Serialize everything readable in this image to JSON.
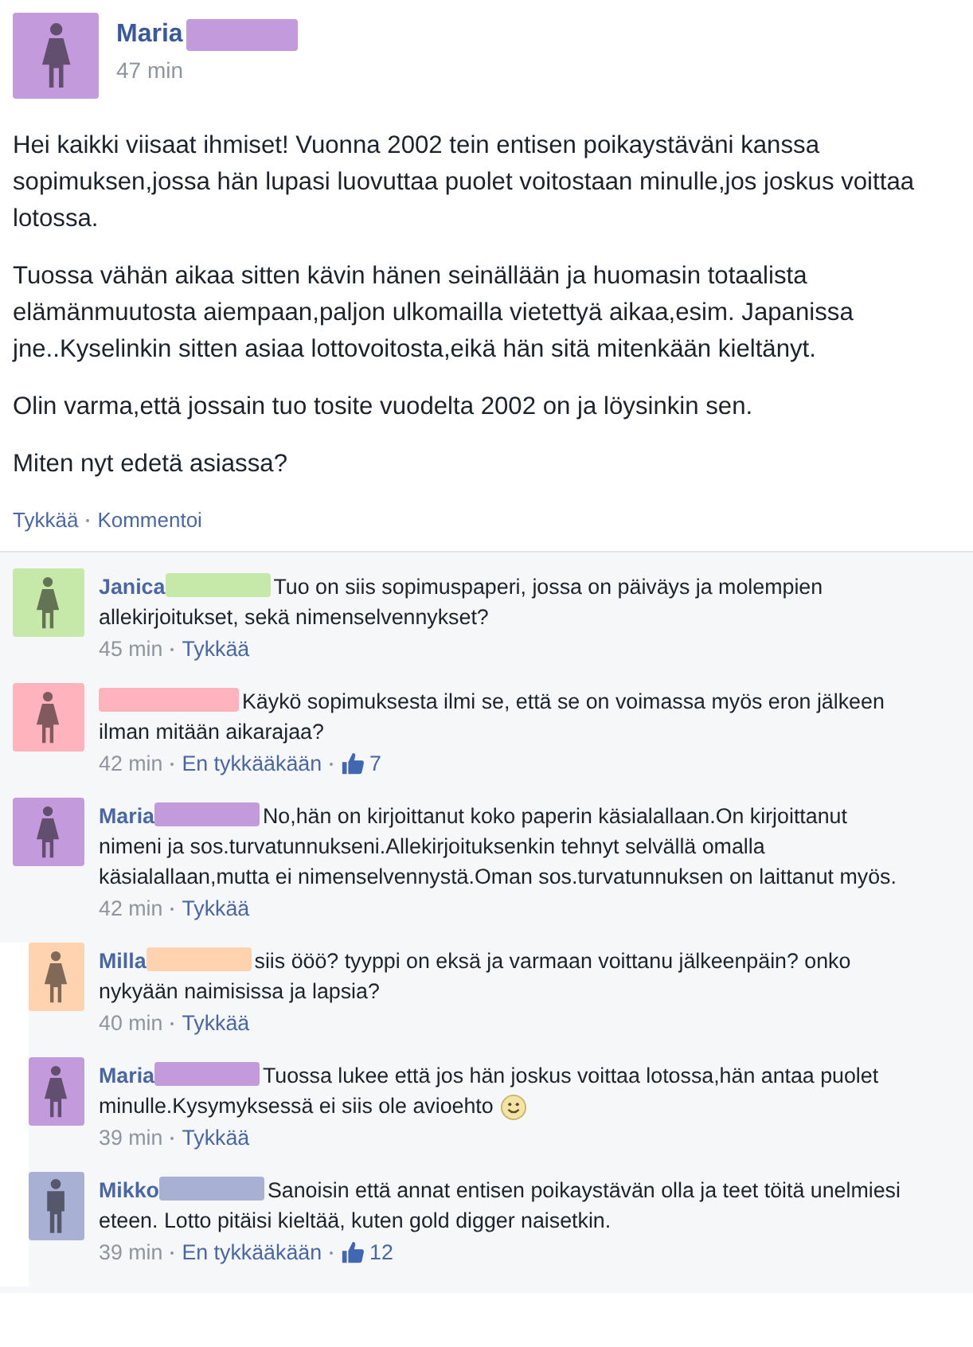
{
  "post": {
    "author": "Maria",
    "avatar": {
      "color": "#c39bdc",
      "kind": "female"
    },
    "time": "47 min",
    "paragraphs": [
      "Hei kaikki viisaat ihmiset! Vuonna 2002 tein entisen poikaystäväni kanssa sopimuksen,jossa hän lupasi luovuttaa puolet voitostaan minulle,jos joskus voittaa lotossa.",
      "Tuossa vähän aikaa sitten kävin hänen seinällään ja huomasin totaalista elämänmuutosta aiempaan,paljon ulkomailla vietettyä aikaa,esim. Japanissa jne..Kyselinkin sitten asiaa lottovoitosta,eikä hän sitä mitenkään kieltänyt.",
      "Olin varma,että jossain tuo tosite vuodelta 2002 on ja löysinkin sen.",
      "Miten nyt edetä asiassa?"
    ],
    "actions": [
      "Tykkää",
      "Kommentoi"
    ]
  },
  "comments": [
    {
      "author": "Janica",
      "avatar": {
        "color": "#c6e8a8",
        "kind": "female"
      },
      "text": "Tuo on siis sopimuspaperi, jossa on päiväys ja molempien allekirjoitukset, sekä nimenselvennykset?",
      "smiley": false,
      "time": "45 min",
      "like_action": "Tykkää",
      "reply": false
    },
    {
      "avatar": {
        "color": "#ffb3bc",
        "kind": "female"
      },
      "text": "Käykö sopimuksesta ilmi se, että se on voimassa myös eron jälkeen ilman mitään aikarajaa?",
      "smiley": false,
      "time": "42 min",
      "like_action": "En tykkääkään",
      "likes": "7",
      "reply": false
    },
    {
      "author": "Maria",
      "avatar": {
        "color": "#c39bdc",
        "kind": "female"
      },
      "text": "No,hän on kirjoittanut koko paperin käsialallaan.On kirjoittanut nimeni ja sos.turvatunnukseni.Allekirjoituksenkin tehnyt selvällä omalla käsialallaan,mutta ei nimenselvennystä.Oman sos.turvatunnuksen on laittanut myös.",
      "smiley": false,
      "time": "42 min",
      "like_action": "Tykkää",
      "reply": false
    },
    {
      "author": "Milla",
      "avatar": {
        "color": "#ffd2b0",
        "kind": "female"
      },
      "text": "siis ööö? tyyppi on eksä ja varmaan voittanu jälkeenpäin? onko nykyään naimisissa ja lapsia?",
      "smiley": false,
      "time": "40 min",
      "like_action": "Tykkää",
      "reply": true
    },
    {
      "author": "Maria",
      "avatar": {
        "color": "#c39bdc",
        "kind": "female"
      },
      "text": "Tuossa lukee että jos hän joskus voittaa lotossa,hän antaa puolet minulle.Kysymyksessä ei siis ole avioehto",
      "smiley": true,
      "time": "39 min",
      "like_action": "Tykkää",
      "reply": true
    },
    {
      "author": "Mikko",
      "avatar": {
        "color": "#a8b0d4",
        "kind": "male"
      },
      "text": "Sanoisin että annat entisen poikaystävän olla ja teet töitä unelmiesi eteen. Lotto pitäisi kieltää, kuten gold digger naisetkin.",
      "smiley": false,
      "time": "39 min",
      "like_action": "En tykkääkään",
      "likes": "12",
      "reply": true
    }
  ]
}
